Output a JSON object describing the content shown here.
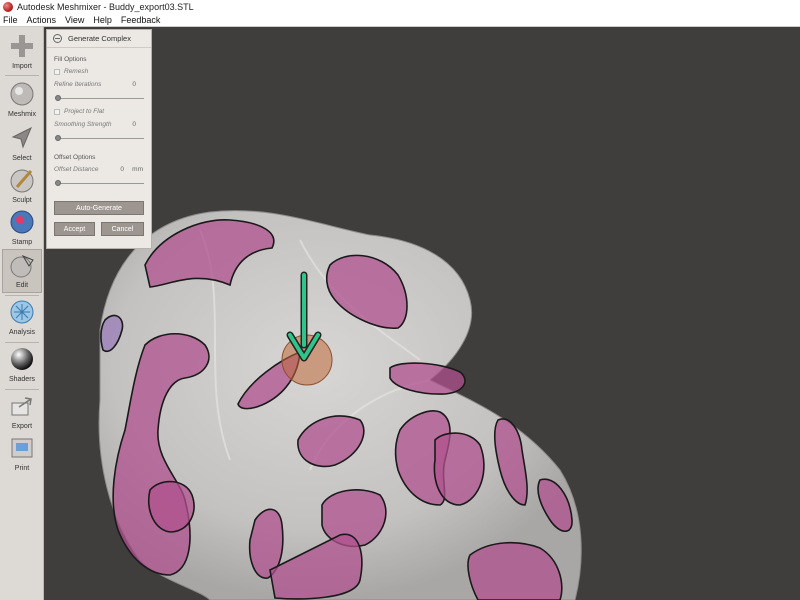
{
  "window": {
    "title": "Autodesk Meshmixer - Buddy_export03.STL"
  },
  "menu": [
    "File",
    "Actions",
    "View",
    "Help",
    "Feedback"
  ],
  "tools": [
    {
      "label": "Import",
      "icon": "plus-icon"
    },
    {
      "label": "Meshmix",
      "icon": "meshmix-icon"
    },
    {
      "label": "Select",
      "icon": "select-arrow-icon"
    },
    {
      "label": "Sculpt",
      "icon": "sculpt-brush-icon"
    },
    {
      "label": "Stamp",
      "icon": "stamp-icon"
    },
    {
      "label": "Edit",
      "icon": "edit-icon",
      "active": true
    },
    {
      "label": "Analysis",
      "icon": "analysis-icon"
    },
    {
      "label": "Shaders",
      "icon": "shaders-icon"
    },
    {
      "label": "Export",
      "icon": "export-icon"
    },
    {
      "label": "Print",
      "icon": "print-icon"
    }
  ],
  "panel": {
    "title": "Generate Complex",
    "fill_options": "Fill Options",
    "remesh": "Remesh",
    "refine_iterations": {
      "label": "Refine Iterations",
      "value": "0",
      "slider": 0
    },
    "project_to_flat": "Project to Flat",
    "smoothing_strength": {
      "label": "Smoothing Strength",
      "value": "0",
      "slider": 0
    },
    "offset_options": "Offset Options",
    "offset_distance": {
      "label": "Offset Distance",
      "value": "0",
      "unit": "mm",
      "slider": 0
    },
    "auto_generate": "Auto-Generate",
    "accept": "Accept",
    "cancel": "Cancel"
  },
  "colors": {
    "viewport_bg": "#3f3e3d",
    "mesh": "#c9c7c5",
    "patch": "#b0518f",
    "arrow": "#2ec48a",
    "marker": "#c06a3a"
  }
}
